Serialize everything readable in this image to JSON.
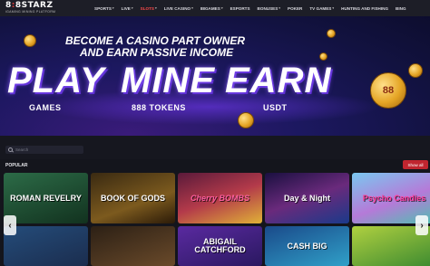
{
  "header": {
    "logo_text_1": "8",
    "logo_text_accent": ":",
    "logo_text_2": "8STARZ",
    "logo_tagline": "iGAMING MINING PLATFORM",
    "nav": [
      {
        "label": "SPORTS",
        "has_chevron": true,
        "active": false
      },
      {
        "label": "LIVE",
        "has_chevron": true,
        "active": false
      },
      {
        "label": "SLOTS",
        "has_chevron": true,
        "active": true
      },
      {
        "label": "LIVE CASINO",
        "has_chevron": true,
        "active": false
      },
      {
        "label": "88GAMES",
        "has_chevron": true,
        "active": false
      },
      {
        "label": "ESPORTS",
        "has_chevron": false,
        "active": false
      },
      {
        "label": "BONUSES",
        "has_chevron": true,
        "active": false
      },
      {
        "label": "POKER",
        "has_chevron": false,
        "active": false
      },
      {
        "label": "TV GAMES",
        "has_chevron": true,
        "active": false
      },
      {
        "label": "HUNTING AND FISHING",
        "has_chevron": false,
        "active": false
      },
      {
        "label": "BING",
        "has_chevron": false,
        "active": false
      }
    ]
  },
  "hero": {
    "sub_line_1": "BECOME A CASINO PART OWNER",
    "sub_line_2": "AND EARN PASSIVE INCOME",
    "big_1": "PLAY",
    "big_2": "MINE",
    "big_3": "EARN",
    "label_1": "GAMES",
    "label_2": "888 TOKENS",
    "label_3": "USDT",
    "coin_text": "88"
  },
  "search": {
    "placeholder": "Search"
  },
  "section": {
    "title": "POPULAR",
    "show_all": "Show all"
  },
  "games": [
    {
      "title": "ROMAN REVELRY"
    },
    {
      "title": "BOOK OF GODS"
    },
    {
      "title": "Cherry BOMBS"
    },
    {
      "title": "Day & Night"
    },
    {
      "title": "Psycho Candies"
    },
    {
      "title": ""
    },
    {
      "title": ""
    },
    {
      "title": "ABIGAIL CATCHFORD"
    },
    {
      "title": "CASH BIG"
    },
    {
      "title": ""
    }
  ],
  "colors": {
    "accent": "#e23b3b",
    "show_all_bg": "#c0252f",
    "active_nav": "#ff4a4a"
  },
  "icons": {
    "search": "search-icon",
    "arrow_left": "arrow-left-icon",
    "arrow_right": "arrow-right-icon"
  }
}
